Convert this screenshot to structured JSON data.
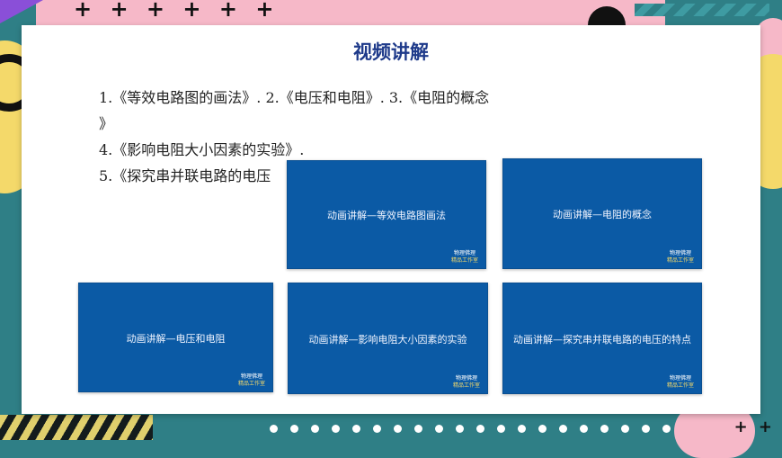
{
  "slide": {
    "title": "视频讲解",
    "list": [
      "1.《等效电路图的画法》.   2.《电压和电阻》.   3.《电阻的概念",
      "》",
      "4.《影响电阻大小因素的实验》.",
      "5.《探究串并联电路的电压"
    ]
  },
  "videos": [
    {
      "label": "动画讲解—等效电路图画法",
      "brand": "物理佛理",
      "brand_sub": "精品工作室"
    },
    {
      "label": "动画讲解—电阻的概念",
      "brand": "物理佛理",
      "brand_sub": "精品工作室"
    },
    {
      "label": "动画讲解—电压和电阻",
      "brand": "物理佛理",
      "brand_sub": "精品工作室"
    },
    {
      "label": "动画讲解—影响电阻大小因素的实验",
      "brand": "物理佛理",
      "brand_sub": "精品工作室"
    },
    {
      "label": "动画讲解—探究串并联电路的电压的特点",
      "brand": "物理佛理",
      "brand_sub": "精品工作室"
    }
  ],
  "decor": {
    "plus_top": "+ + + + + +",
    "plus_bottom": "+ +",
    "colors": {
      "teal": "#2f7f86",
      "pink": "#f6b8c8",
      "yellow": "#f4d96a",
      "blue": "#0b5aa5",
      "title": "#1e3a8a"
    }
  }
}
